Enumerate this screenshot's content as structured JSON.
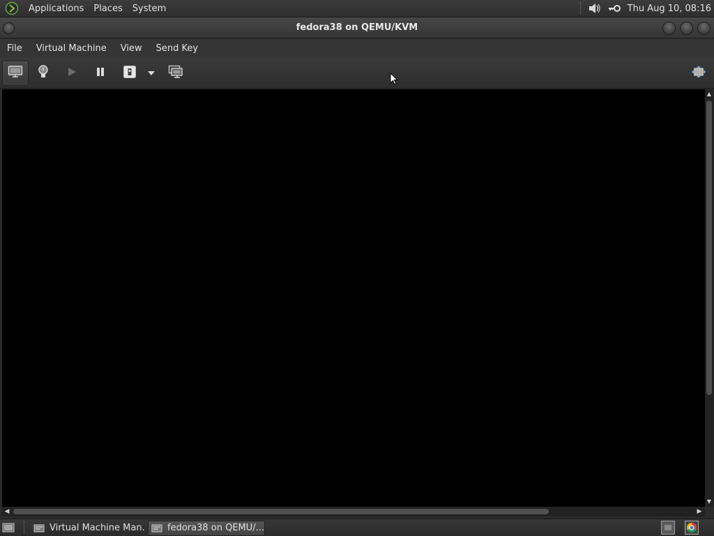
{
  "top_panel": {
    "menus": [
      "Applications",
      "Places",
      "System"
    ],
    "clock": "Thu Aug 10, 08:16",
    "tray_icons": [
      "volume-icon",
      "key-icon"
    ]
  },
  "window": {
    "title": "fedora38 on QEMU/KVM",
    "menubar": [
      "File",
      "Virtual Machine",
      "View",
      "Send Key"
    ],
    "toolbar": {
      "show_console": "monitor-icon",
      "show_details": "lightbulb-icon",
      "run": "play-icon",
      "pause": "pause-icon",
      "shutdown": "power-icon",
      "shutdown_menu": "chevron-down-icon",
      "snapshots": "snapshot-icon",
      "fullscreen": "fullscreen-icon"
    },
    "console_background": "#000000"
  },
  "bottom_panel": {
    "tasks": [
      {
        "label": "Virtual Machine Man...",
        "active": false
      },
      {
        "label": "fedora38 on QEMU/...",
        "active": true
      }
    ]
  }
}
